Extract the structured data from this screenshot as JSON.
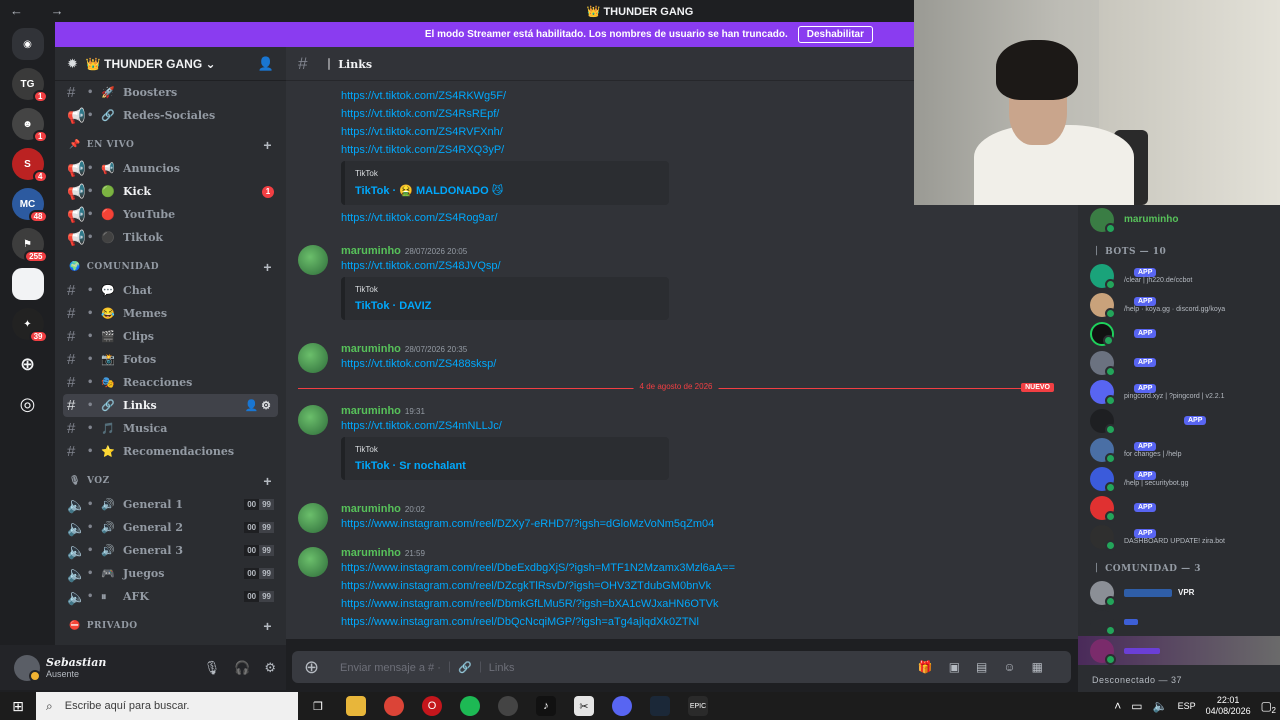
{
  "window": {
    "title": "👑 THUNDER GANG",
    "nav_arrows": "← →"
  },
  "banner": {
    "text": "El modo Streamer está habilitado. Los nombres de usuario se han truncado.",
    "button": "Deshabilitar"
  },
  "rail": {
    "servers": [
      {
        "name": "discord-home",
        "badge": ""
      },
      {
        "name": "server-thunder",
        "badge": "1"
      },
      {
        "name": "server-2",
        "badge": "1"
      },
      {
        "name": "server-s",
        "badge": "4"
      },
      {
        "name": "server-mcpo",
        "badge": "48"
      },
      {
        "name": "server-255",
        "badge": "255"
      },
      {
        "name": "server-white",
        "badge": ""
      },
      {
        "name": "server-39",
        "badge": "39"
      }
    ]
  },
  "server": {
    "name": "👑 THUNDER GANG ⌄"
  },
  "sidebar": {
    "top_channels": [
      {
        "emoji": "🚀",
        "label": "Boosters"
      },
      {
        "emoji": "🔗",
        "label": "Redes-Sociales"
      }
    ],
    "cat_live": "EN VIVO",
    "live_channels": [
      {
        "emoji": "📢",
        "label": "Anuncios"
      },
      {
        "emoji": "🟢",
        "label": "Kick",
        "ping": "1"
      },
      {
        "emoji": "🔴",
        "label": "YouTube"
      },
      {
        "emoji": "⚫",
        "label": "Tiktok"
      }
    ],
    "cat_community": "COMUNIDAD",
    "community_channels": [
      {
        "emoji": "💬",
        "label": "Chat"
      },
      {
        "emoji": "😂",
        "label": "Memes"
      },
      {
        "emoji": "🎬",
        "label": "Clips"
      },
      {
        "emoji": "📸",
        "label": "Fotos"
      },
      {
        "emoji": "🎭",
        "label": "Reacciones"
      },
      {
        "emoji": "🔗",
        "label": "Links"
      },
      {
        "emoji": "🎵",
        "label": "Musica"
      },
      {
        "emoji": "⭐",
        "label": "Recomendaciones"
      }
    ],
    "cat_voice": "VOZ",
    "voice_channels": [
      {
        "emoji": "🔊",
        "label": "General 1",
        "a": "00",
        "b": "99"
      },
      {
        "emoji": "🔊",
        "label": "General 2",
        "a": "00",
        "b": "99"
      },
      {
        "emoji": "🔊",
        "label": "General 3",
        "a": "00",
        "b": "99"
      },
      {
        "emoji": "🎮",
        "label": "Juegos",
        "a": "00",
        "b": "99"
      },
      {
        "emoji": "⏸",
        "label": "AFK",
        "a": "00",
        "b": "99"
      }
    ],
    "cat_private": "PRIVADO"
  },
  "user": {
    "name": "Sebastian",
    "status": "Ausente"
  },
  "channel": {
    "name": "｜ Links"
  },
  "chat": {
    "top_links": [
      "https://vt.tiktok.com/ZS4RKWg5F/",
      "https://vt.tiktok.com/ZS4RsREpf/",
      "https://vt.tiktok.com/ZS4RVFXnh/",
      "https://vt.tiktok.com/ZS4RXQ3yP/"
    ],
    "embed1": {
      "provider": "TikTok",
      "title": "TikTok · 🤮 MALDONADO 😼"
    },
    "link_after_embed1": "https://vt.tiktok.com/ZS4Rog9ar/",
    "m1": {
      "author": "maruminho",
      "time": "28/07/2026 20:05",
      "link": "https://vt.tiktok.com/ZS48JVQsp/",
      "embed": {
        "provider": "TikTok",
        "title": "TikTok · DAVIZ"
      }
    },
    "m2": {
      "author": "maruminho",
      "time": "28/07/2026 20:35",
      "link": "https://vt.tiktok.com/ZS488sksp/"
    },
    "divider": {
      "date": "4 de agosto de 2026",
      "new": "NUEVO"
    },
    "m3": {
      "author": "maruminho",
      "time": "19:31",
      "link": "https://vt.tiktok.com/ZS4mNLLJc/",
      "embed": {
        "provider": "TikTok",
        "title": "TikTok · Sr nochalant"
      }
    },
    "m4": {
      "author": "maruminho",
      "time": "20:02",
      "link": "https://www.instagram.com/reel/DZXy7-eRHD7/?igsh=dGloMzVoNm5qZm04"
    },
    "m5": {
      "author": "maruminho",
      "time": "21:59",
      "links": [
        "https://www.instagram.com/reel/DbeExdbgXjS/?igsh=MTF1N2Mzamx3Mzl6aA==",
        "https://www.instagram.com/reel/DZcgkTlRsvD/?igsh=OHV3ZTdubGM0bnVk",
        "https://www.instagram.com/reel/DbmkGfLMu5R/?igsh=bXA1cWJxaHN6OTVk",
        "https://www.instagram.com/reel/DbQcNcqiMGP/?igsh=aTg4ajlqdXk0ZTNl"
      ]
    }
  },
  "composer": {
    "placeholder": "Enviar mensaje a # · ｜ 🔗 ｜ Links"
  },
  "members": {
    "top_member": "maruminho",
    "bots_header": "｜ BOTS — 10",
    "app_label": "APP",
    "bots": [
      {
        "sub": "/clear | jh220.de/ccbot"
      },
      {
        "sub": "/help · koya.gg · discord.gg/koya"
      },
      {
        "sub": ""
      },
      {
        "sub": ""
      },
      {
        "sub": "pingcord.xyz | ?pingcord | v2.2.1"
      },
      {
        "sub": ""
      },
      {
        "sub": "for changes | /help"
      },
      {
        "sub": "/help | securitybot.gg"
      },
      {
        "sub": ""
      },
      {
        "sub": "DASHBOARD UPDATE! zira.bot"
      }
    ],
    "community_header": "｜ COMUNIDAD — 3",
    "community_tag": "VPR",
    "offline_header": "Desconectado — 37"
  },
  "taskbar": {
    "search_placeholder": "Escribe aquí para buscar.",
    "lang": "ESP",
    "time": "22:01",
    "date": "04/08/2026",
    "notif_count": "2"
  }
}
